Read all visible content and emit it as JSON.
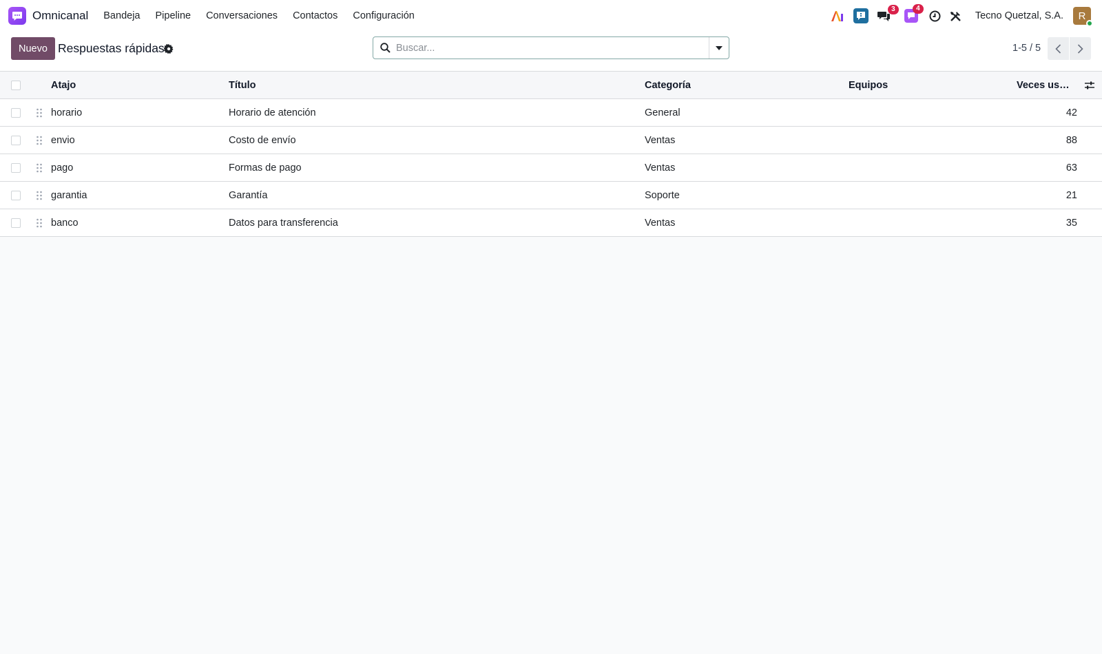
{
  "app": {
    "name": "Omnicanal",
    "accent": "#7c3aed"
  },
  "nav": {
    "menu": [
      "Bandeja",
      "Pipeline",
      "Conversaciones",
      "Contactos",
      "Configuración"
    ],
    "systray": {
      "messages_badge": "3",
      "activities_badge": "4",
      "company": "Tecno Quetzal, S.A.",
      "avatar_initial": "R"
    }
  },
  "control": {
    "new_button": "Nuevo",
    "title": "Respuestas rápidas",
    "search_placeholder": "Buscar...",
    "pager": "1-5 / 5",
    "primary_color": "#714b67"
  },
  "table": {
    "columns": {
      "atajo": "Atajo",
      "titulo": "Título",
      "categoria": "Categoría",
      "equipos": "Equipos",
      "veces": "Veces usada"
    },
    "rows": [
      {
        "atajo": "horario",
        "titulo": "Horario de atención",
        "categoria": "General",
        "equipos": "",
        "veces": "42"
      },
      {
        "atajo": "envio",
        "titulo": "Costo de envío",
        "categoria": "Ventas",
        "equipos": "",
        "veces": "88"
      },
      {
        "atajo": "pago",
        "titulo": "Formas de pago",
        "categoria": "Ventas",
        "equipos": "",
        "veces": "63"
      },
      {
        "atajo": "garantia",
        "titulo": "Garantía",
        "categoria": "Soporte",
        "equipos": "",
        "veces": "21"
      },
      {
        "atajo": "banco",
        "titulo": "Datos para transferencia",
        "categoria": "Ventas",
        "equipos": "",
        "veces": "35"
      }
    ]
  }
}
